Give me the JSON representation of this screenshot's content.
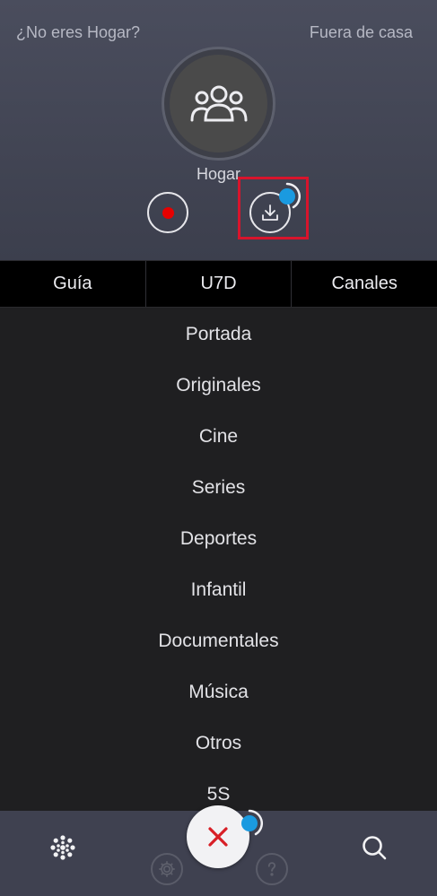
{
  "header": {
    "not_user_link": "¿No eres Hogar?",
    "away_link": "Fuera de casa",
    "profile_name": "Hogar",
    "avatar_icon": "group-users-icon",
    "record_icon": "record-icon",
    "download_icon": "download-icon"
  },
  "tabs": [
    {
      "label": "Guía"
    },
    {
      "label": "U7D"
    },
    {
      "label": "Canales"
    }
  ],
  "menu": {
    "items": [
      {
        "label": "Portada"
      },
      {
        "label": "Originales"
      },
      {
        "label": "Cine"
      },
      {
        "label": "Series"
      },
      {
        "label": "Deportes"
      },
      {
        "label": "Infantil"
      },
      {
        "label": "Documentales"
      },
      {
        "label": "Música"
      },
      {
        "label": "Otros"
      },
      {
        "label": "5S"
      }
    ]
  },
  "bottom_bar": {
    "left_icon": "dots-grid-icon",
    "center_icon": "close-icon",
    "right_icon": "search-icon",
    "faded_left_icon": "gear-icon",
    "faded_right_icon": "help-icon"
  },
  "colors": {
    "record": "#e60000",
    "progress_badge": "#1a9ae0",
    "highlight": "#d8142c",
    "close_x": "#d81f26"
  }
}
